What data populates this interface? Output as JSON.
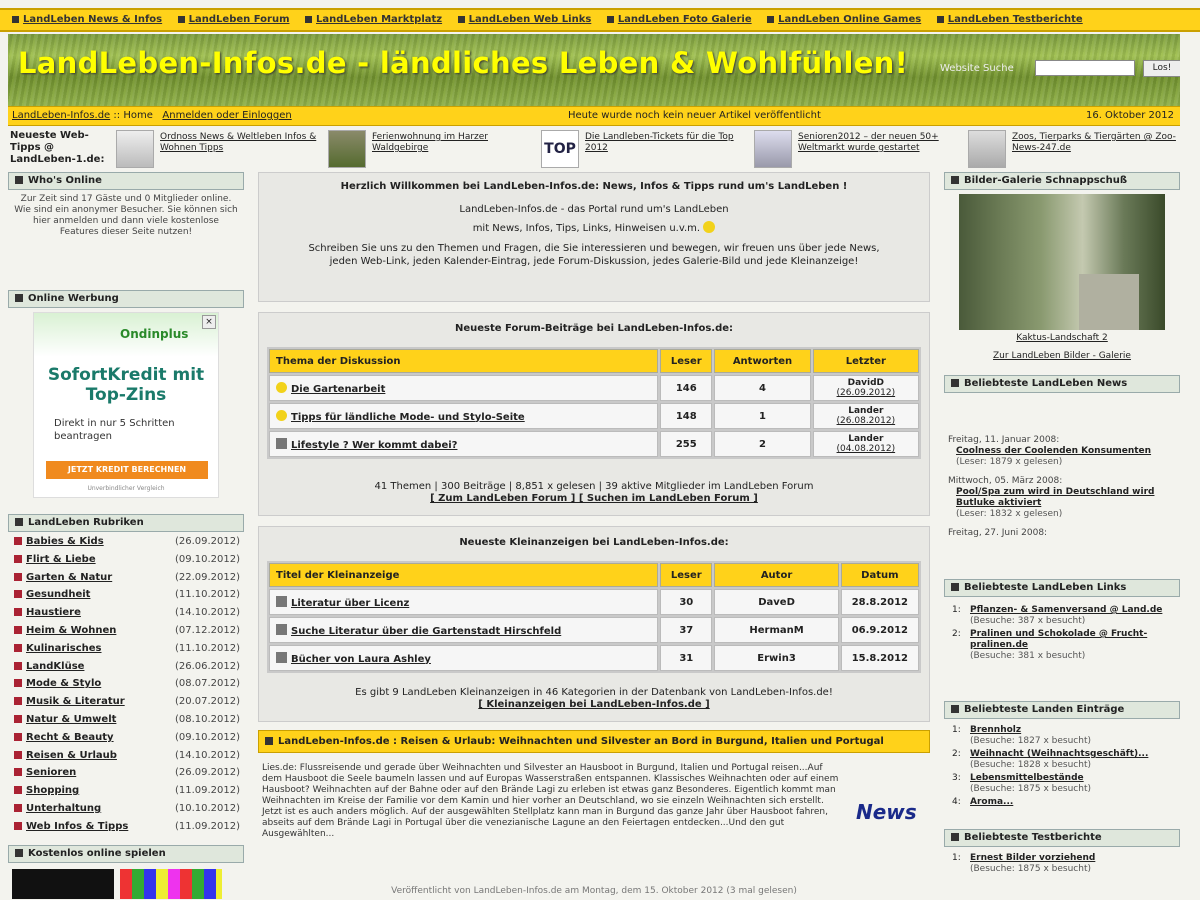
{
  "nav": {
    "items": [
      "LandLeben News & Infos",
      "LandLeben Forum",
      "LandLeben Marktplatz",
      "LandLeben Web Links",
      "LandLeben Foto Galerie",
      "LandLeben Online Games",
      "LandLeben Testberichte"
    ]
  },
  "banner": {
    "title": "LandLeben-Infos.de - ländliches Leben & Wohlfühlen!",
    "search_label": "Website Suche",
    "search_value": "",
    "search_button": "Los!"
  },
  "statusbar": {
    "breadcrumb_site": "LandLeben-Infos.de",
    "breadcrumb_sep": "::",
    "breadcrumb_home": "Home",
    "login_links": "Anmelden oder Einloggen",
    "status_text": "Heute wurde noch kein neuer Artikel veröffentlicht",
    "date": "16. Oktober 2012"
  },
  "tips": {
    "label": "Neueste Web-Tipps @ LandLeben-1.de:",
    "items": [
      {
        "text": "Ordnoss News & Weltleben Infos & Wohnen Tipps"
      },
      {
        "text": "Ferienwohnung im Harzer Waldgebirge"
      },
      {
        "text": "Die Landleben-Tickets für die Top 2012"
      },
      {
        "text": "Senioren2012 – der neuen 50+ Weltmarkt wurde gestartet"
      },
      {
        "text": "Zoos, Tierparks & Tiergärten @ Zoo-News-247.de"
      }
    ]
  },
  "left": {
    "whos_online_title": "Who's Online",
    "whos_online_text": "Zur Zeit sind 17 Gäste und 0 Mitglieder online. Wie sind ein anonymer Besucher. Sie können sich hier anmelden und dann viele kostenlose Features dieser Seite nutzen!",
    "ad_title": "Online Werbung",
    "ad": {
      "logo": "Ondinplus",
      "close": "×",
      "headline": "SofortKredit mit Top-Zins",
      "sub": "Direkt in nur 5 Schritten beantragen",
      "cta": "JETZT KREDIT BERECHNEN",
      "foot": "Unverbindlicher Vergleich"
    },
    "cat_title": "LandLeben Rubriken",
    "categories": [
      {
        "name": "Babies & Kids",
        "date": "(26.09.2012)"
      },
      {
        "name": "Flirt & Liebe",
        "date": "(09.10.2012)"
      },
      {
        "name": "Garten & Natur",
        "date": "(22.09.2012)"
      },
      {
        "name": "Gesundheit",
        "date": "(11.10.2012)"
      },
      {
        "name": "Haustiere",
        "date": "(14.10.2012)"
      },
      {
        "name": "Heim & Wohnen",
        "date": "(07.12.2012)"
      },
      {
        "name": "Kulinarisches",
        "date": "(11.10.2012)"
      },
      {
        "name": "LandKlüse",
        "date": "(26.06.2012)"
      },
      {
        "name": "Mode & Stylo",
        "date": "(08.07.2012)"
      },
      {
        "name": "Musik & Literatur",
        "date": "(20.07.2012)"
      },
      {
        "name": "Natur & Umwelt",
        "date": "(08.10.2012)"
      },
      {
        "name": "Recht & Beauty",
        "date": "(09.10.2012)"
      },
      {
        "name": "Reisen & Urlaub",
        "date": "(14.10.2012)"
      },
      {
        "name": "Senioren",
        "date": "(26.09.2012)"
      },
      {
        "name": "Shopping",
        "date": "(11.09.2012)"
      },
      {
        "name": "Unterhaltung",
        "date": "(10.10.2012)"
      },
      {
        "name": "Web Infos & Tipps",
        "date": "(11.09.2012)"
      }
    ],
    "games_title": "Kostenlos online spielen"
  },
  "welcome": {
    "title": "Herzlich Willkommen bei LandLeben-Infos.de: News, Infos & Tipps rund um's LandLeben !",
    "line1": "LandLeben-Infos.de - das Portal rund um's LandLeben",
    "line2": "mit News, Infos, Tips, Links, Hinweisen u.v.m.",
    "line3": "Schreiben Sie uns zu den Themen und Fragen, die Sie interessieren und bewegen, wir freuen uns über jede News, jeden Web-Link, jeden Kalender-Eintrag, jede Forum-Diskussion, jedes Galerie-Bild und jede Kleinanzeige!"
  },
  "forum": {
    "title": "Neueste Forum-Beiträge bei LandLeben-Infos.de:",
    "headers": [
      "Thema der Diskussion",
      "Leser",
      "Antworten",
      "Letzter"
    ],
    "rows": [
      {
        "icon": "smile",
        "topic": "Die Gartenarbeit",
        "readers": "146",
        "answers": "4",
        "last_user": "DavidD",
        "last_date": "(26.09.2012)"
      },
      {
        "icon": "smile",
        "topic": "Tipps für ländliche Mode- und Stylo-Seite",
        "readers": "148",
        "answers": "1",
        "last_user": "Lander",
        "last_date": "(26.08.2012)"
      },
      {
        "icon": "envelope",
        "topic": "Lifestyle ? Wer kommt dabei?",
        "readers": "255",
        "answers": "2",
        "last_user": "Lander",
        "last_date": "(04.08.2012)"
      }
    ],
    "footer1": "41 Themen | 300 Beiträge | 8,851 x gelesen | 39 aktive Mitglieder im LandLeben Forum",
    "footer2": "[ Zum LandLeben Forum ] [ Suchen im LandLeben Forum ]"
  },
  "classifieds": {
    "title": "Neueste Kleinanzeigen bei LandLeben-Infos.de:",
    "headers": [
      "Titel der Kleinanzeige",
      "Leser",
      "Autor",
      "Datum"
    ],
    "rows": [
      {
        "title": "Literatur über Licenz",
        "readers": "30",
        "author": "DaveD",
        "date": "28.8.2012"
      },
      {
        "title": "Suche Literatur über die Gartenstadt Hirschfeld",
        "readers": "37",
        "author": "HermanM",
        "date": "06.9.2012"
      },
      {
        "title": "Bücher von Laura Ashley",
        "readers": "31",
        "author": "Erwin3",
        "date": "15.8.2012"
      }
    ],
    "footer1": "Es gibt 9 LandLeben Kleinanzeigen in 46 Kategorien in der Datenbank von LandLeben-Infos.de!",
    "footer2": "[ Kleinanzeigen bei LandLeben-Infos.de ]"
  },
  "featured": {
    "head": "LandLeben-Infos.de : Reisen & Urlaub: Weihnachten und Silvester an Bord in Burgund, Italien und Portugal",
    "body": "Lies.de: Flussreisende und gerade über Weihnachten und Silvester an Hausboot in Burgund, Italien und Portugal reisen...Auf dem Hausboot die Seele baumeln lassen und auf Europas Wasserstraßen entspannen. Klassisches Weihnachten oder auf einem Hausboot? Weihnachten auf der Bahne oder auf den Brände Lagi zu erleben ist etwas ganz Besonderes. Eigentlich kommt man Weihnachten im Kreise der Familie vor dem Kamin und hier vorher an Deutschland, wo sie einzeln Weihnachten sich erstellt. Jetzt ist es auch anders möglich. Auf der ausgewählten Stellplatz kann man in Burgund das ganze Jahr über Hausboot fahren, abseits auf dem Brände Lagi in Portugal über die venezianische Lagune an den Feiertagen entdecken...Und den gut Ausgewählten...",
    "news_logo": "News"
  },
  "bottomline": "Veröffentlicht von LandLeben-Infos.de am Montag, dem 15. Oktober 2012 (3 mal gelesen)",
  "right": {
    "gallery_title": "Bilder-Galerie Schnappschuß",
    "gallery_caption": "Kaktus-Landschaft 2",
    "gallery_link": "Zur LandLeben Bilder - Galerie",
    "news_title": "Beliebteste LandLeben News",
    "news": [
      {
        "date": "Freitag, 11. Januar 2008:",
        "title": "Coolness der Coolenden Konsumenten",
        "reads": "(Leser: 1879 x gelesen)"
      },
      {
        "date": "Mittwoch, 05. März 2008:",
        "title": "Pool/Spa zum wird in Deutschland wird Butluke aktiviert",
        "reads": "(Leser: 1832 x gelesen)"
      },
      {
        "date": "Freitag, 27. Juni 2008:",
        "title": "",
        "reads": ""
      }
    ],
    "links_title": "Beliebteste LandLeben Links",
    "links": [
      {
        "n": "1:",
        "title": "Pflanzen- & Samenversand @ Land.de",
        "visits": "(Besuche: 387 x besucht)"
      },
      {
        "n": "2:",
        "title": "Pralinen und Schokolade @ Frucht-pralinen.de",
        "visits": "(Besuche: 381 x besucht)"
      }
    ],
    "tips_title": "Beliebteste Landen Einträge",
    "tips": [
      {
        "n": "1:",
        "title": "Brennholz",
        "visits": "(Besuche: 1827 x besucht)"
      },
      {
        "n": "2:",
        "title": "Weihnacht (Weihnachtsgeschäft)...",
        "visits": "(Besuche: 1828 x besucht)"
      },
      {
        "n": "3:",
        "title": "Lebensmittelbestände",
        "visits": "(Besuche: 1875 x besucht)"
      },
      {
        "n": "4:",
        "title": "Aroma...",
        "visits": ""
      }
    ],
    "tests_title": "Beliebteste Testberichte",
    "tests": [
      {
        "n": "1:",
        "title": "Ernest Bilder vorziehend",
        "visits": "(Besuche: 1875 x besucht)"
      }
    ]
  }
}
